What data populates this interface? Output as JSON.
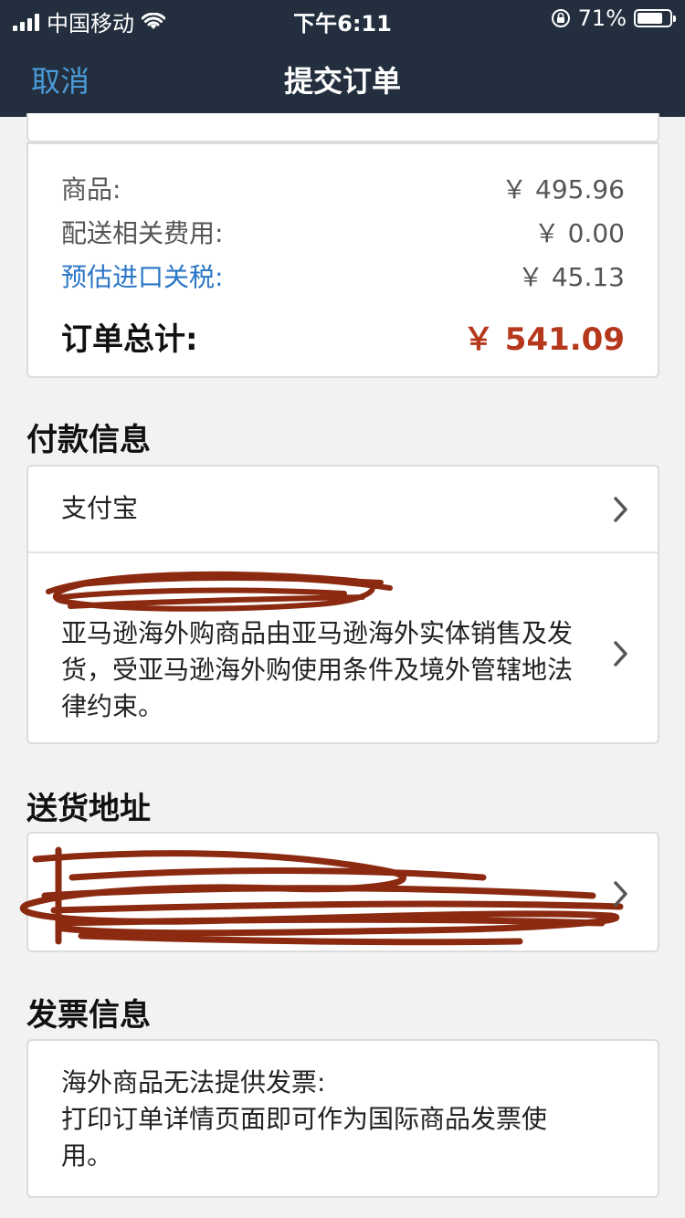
{
  "status_bar": {
    "carrier": "中国移动",
    "time": "下午6:11",
    "battery": "71%"
  },
  "nav": {
    "cancel": "取消",
    "title": "提交订单"
  },
  "summary": {
    "items_label": "商品:",
    "items_value": "￥ 495.96",
    "shipping_label": "配送相关费用:",
    "shipping_value": "￥ 0.00",
    "tax_label": "预估进口关税:",
    "tax_value": "￥ 45.13",
    "total_label": "订单总计:",
    "total_value": "￥ 541.09"
  },
  "payment": {
    "section_title": "付款信息",
    "method": "支付宝",
    "notice": "亚马逊海外购商品由亚马逊海外实体销售及发货，受亚马逊海外购使用条件及境外管辖地法律约束。"
  },
  "shipping": {
    "section_title": "送货地址"
  },
  "invoice": {
    "section_title": "发票信息",
    "line1": "海外商品无法提供发票:",
    "line2": "打印订单详情页面即可作为国际商品发票使用。"
  },
  "colors": {
    "header_bg": "#232f3e",
    "link": "#2a76c6",
    "total": "#b5381c",
    "scribble": "#8b2a10"
  }
}
